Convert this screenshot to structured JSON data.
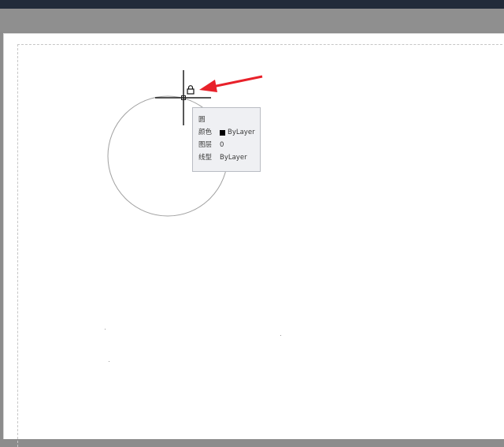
{
  "tooltip": {
    "title": "圆",
    "rows": [
      {
        "key": "颜色",
        "value": "ByLayer",
        "has_swatch": true
      },
      {
        "key": "图层",
        "value": "0",
        "has_swatch": false
      },
      {
        "key": "线型",
        "value": "ByLayer",
        "has_swatch": false
      }
    ],
    "swatch_color": "#000000"
  },
  "colors": {
    "annotation_arrow": "#e8212a",
    "circle_stroke": "#a0a0a0",
    "crosshair": "#1f1f1f",
    "canvas": "#ffffff",
    "workspace": "#8c8c8c"
  },
  "icons": {
    "cursor_badge": "lock-icon",
    "pickbox": "pickbox-icon"
  }
}
